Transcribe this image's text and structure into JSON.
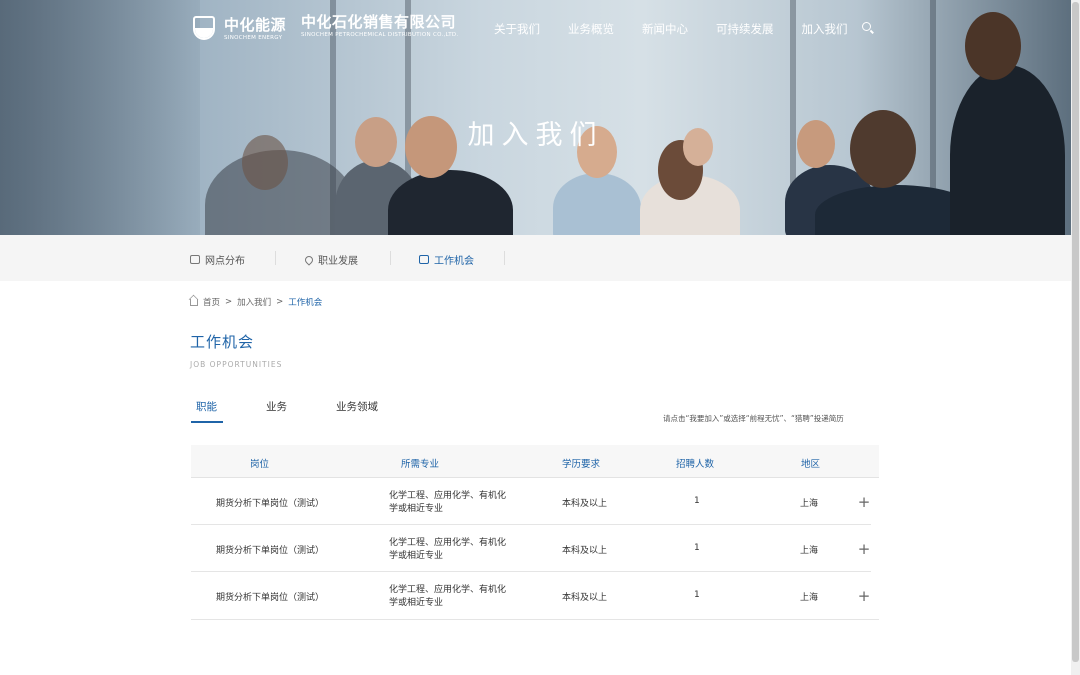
{
  "header": {
    "logo1": {
      "cn": "中化能源",
      "en": "SINOCHEM ENERGY"
    },
    "logo2": {
      "cn": "中化石化销售有限公司",
      "en": "SINOCHEM PETROCHEMICAL DISTRIBUTION CO.,LTD."
    },
    "nav": [
      "关于我们",
      "业务概览",
      "新闻中心",
      "可持续发展",
      "加入我们"
    ]
  },
  "hero": {
    "title": "加入我们"
  },
  "subnav": [
    {
      "label": "网点分布",
      "icon": "camera-icon"
    },
    {
      "label": "职业发展",
      "icon": "location-pin-icon"
    },
    {
      "label": "工作机会",
      "icon": "briefcase-icon"
    }
  ],
  "breadcrumb": {
    "home": "首页",
    "sep": ">",
    "level1": "加入我们",
    "current": "工作机会"
  },
  "page": {
    "title": "工作机会",
    "subtitle": "JOB OPPORTUNITIES"
  },
  "tabs": [
    "职能",
    "业务",
    "业务领域"
  ],
  "hint": "请点击“我要加入”或选择“前程无忧”、“猎聘”投递简历",
  "table": {
    "headers": [
      "岗位",
      "所需专业",
      "学历要求",
      "招聘人数",
      "地区"
    ],
    "rows": [
      {
        "position": "期货分析下单岗位（测试）",
        "major": "化学工程、应用化学、有机化学或相近专业",
        "education": "本科及以上",
        "count": "1",
        "area": "上海"
      },
      {
        "position": "期货分析下单岗位（测试）",
        "major": "化学工程、应用化学、有机化学或相近专业",
        "education": "本科及以上",
        "count": "1",
        "area": "上海"
      },
      {
        "position": "期货分析下单岗位（测试）",
        "major": "化学工程、应用化学、有机化学或相近专业",
        "education": "本科及以上",
        "count": "1",
        "area": "上海"
      }
    ],
    "expand_symbol": "+"
  }
}
